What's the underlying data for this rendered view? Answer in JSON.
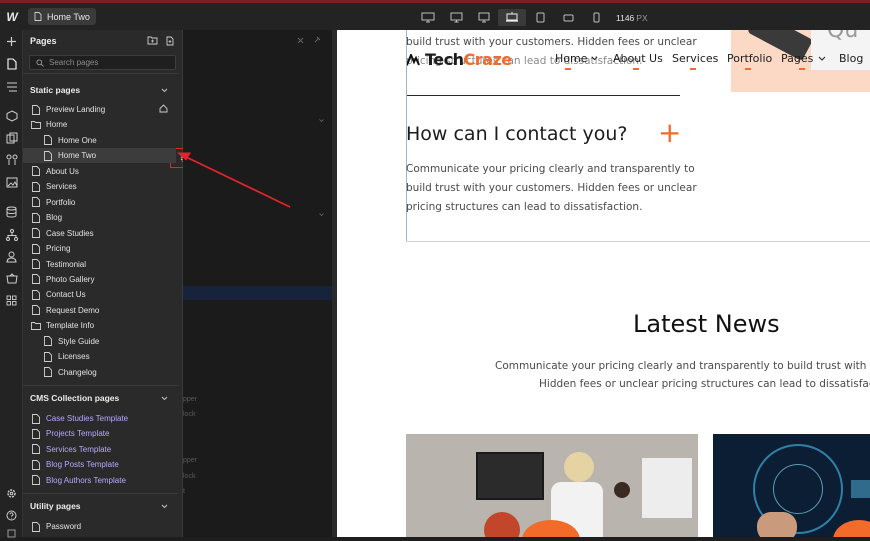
{
  "topbar": {
    "page_name": "Home Two",
    "width_value": "1146",
    "width_unit": "PX"
  },
  "pages_panel": {
    "title": "Pages",
    "search_placeholder": "Search pages",
    "static_section": "Static pages",
    "static_items": [
      {
        "label": "Preview Landing",
        "type": "page",
        "indent": 0
      },
      {
        "label": "Home",
        "type": "folder",
        "indent": 0
      },
      {
        "label": "Home One",
        "type": "page",
        "indent": 1
      },
      {
        "label": "Home Two",
        "type": "page",
        "indent": 1,
        "selected": true
      },
      {
        "label": "About Us",
        "type": "page",
        "indent": 0
      },
      {
        "label": "Services",
        "type": "page",
        "indent": 0
      },
      {
        "label": "Portfolio",
        "type": "page",
        "indent": 0
      },
      {
        "label": "Blog",
        "type": "page",
        "indent": 0
      },
      {
        "label": "Case Studies",
        "type": "page",
        "indent": 0
      },
      {
        "label": "Pricing",
        "type": "page",
        "indent": 0
      },
      {
        "label": "Testimonial",
        "type": "page",
        "indent": 0
      },
      {
        "label": "Photo Gallery",
        "type": "page",
        "indent": 0
      },
      {
        "label": "Contact Us",
        "type": "page",
        "indent": 0
      },
      {
        "label": "Request Demo",
        "type": "page",
        "indent": 0
      },
      {
        "label": "Template Info",
        "type": "folder",
        "indent": 0
      },
      {
        "label": "Style Guide",
        "type": "page",
        "indent": 1
      },
      {
        "label": "Licenses",
        "type": "page",
        "indent": 1
      },
      {
        "label": "Changelog",
        "type": "page",
        "indent": 1
      }
    ],
    "cms_section": "CMS Collection pages",
    "cms_items": [
      "Case Studies Template",
      "Projects Template",
      "Services Template",
      "Blog Posts Template",
      "Blog Authors Template"
    ],
    "utility_section": "Utility pages",
    "utility_items": [
      "Password"
    ]
  },
  "hidden_panel": {
    "fragments": [
      "pper",
      "lock",
      "pper",
      "lock",
      "t"
    ]
  },
  "canvas": {
    "logo_main": "Tech",
    "logo_accent": "Craze",
    "nav": [
      "Home",
      "About Us",
      "Services",
      "Portfolio",
      "Pages",
      "Blog"
    ],
    "faq_top_line1": "build trust with your customers. Hidden fees or unclear",
    "faq_top_line2": "pricing structures can lead to dissatisfaction.",
    "faq_question": "How can I contact you?",
    "faq_toggle": "+",
    "faq_answer_lines": [
      "Communicate your pricing clearly and transparently to",
      "build trust with your customers. Hidden fees or unclear",
      "pricing structures can lead to dissatisfaction."
    ],
    "news_title": "Latest News",
    "news_sub_line1": "Communicate your pricing clearly and transparently to build trust with your cu",
    "news_sub_line2": "Hidden fees or unclear pricing structures can lead to dissatisfaction.",
    "hero_fragment": "Qu"
  },
  "colors": {
    "accent": "#f26b2a",
    "highlight_box": "#e0242a",
    "cms_text": "#b8a7ff"
  }
}
